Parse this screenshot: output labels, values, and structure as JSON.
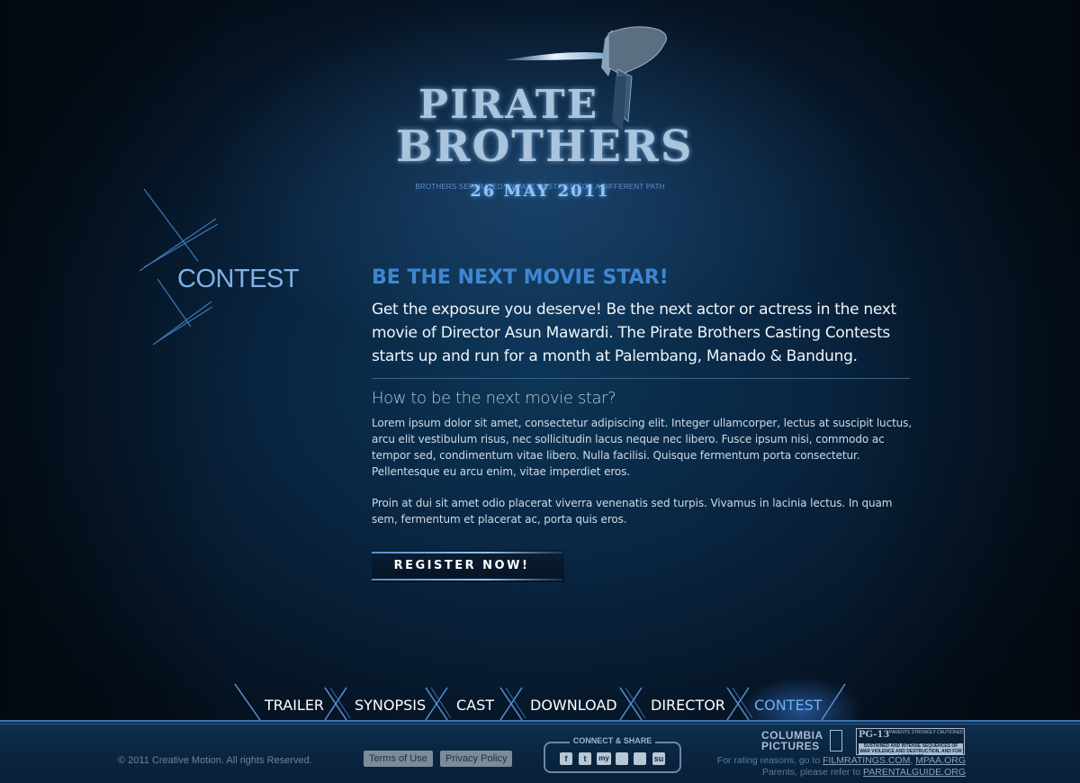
{
  "logo": {
    "title_line1": "PIRATE",
    "title_line2": "BROTHERS",
    "tagline": "BROTHERS SEPARATED BY FATE DESTINED FOR A DIFFERENT PATH"
  },
  "release_date": "26 MAY 2011",
  "section_title": "CONTEST",
  "main": {
    "headline": "BE THE NEXT MOVIE STAR!",
    "intro": "Get the exposure you deserve! Be the next actor or actress in the next movie of Director Asun Mawardi. The Pirate Brothers Casting Contests starts up and run for a month at Palembang, Manado & Bandung.",
    "subhead": "How to be the next movie star?",
    "paragraph1": "Lorem ipsum dolor sit amet, consectetur adipiscing elit. Integer ullamcorper, lectus at suscipit luctus, arcu elit vestibulum risus, nec sollicitudin lacus neque nec libero. Fusce ipsum nisi, commodo ac tempor sed, condimentum vitae libero. Nulla facilisi. Quisque fermentum porta consectetur. Pellentesque eu arcu enim, vitae imperdiet eros.",
    "paragraph2": "Proin at dui sit amet odio placerat viverra venenatis sed turpis. Vivamus in lacinia lectus. In quam sem, fermentum et placerat ac, porta quis eros.",
    "register_label": "REGISTER NOW!"
  },
  "nav": {
    "items": [
      {
        "label": "TRAILER",
        "active": false
      },
      {
        "label": "SYNOPSIS",
        "active": false
      },
      {
        "label": "CAST",
        "active": false
      },
      {
        "label": "DOWNLOAD",
        "active": false
      },
      {
        "label": "DIRECTOR",
        "active": false
      },
      {
        "label": "CONTEST",
        "active": true
      }
    ]
  },
  "footer": {
    "copyright": "© 2011 Creative Motion. All rights Reserved.",
    "terms_label": "Terms of Use",
    "privacy_label": "Privacy Policy",
    "connect_title": "CONNECT & SHARE",
    "social_icons": [
      "facebook-icon",
      "twitter-icon",
      "myspace-icon",
      "delicious-icon",
      "digg-icon",
      "stumbleupon-icon"
    ],
    "social_glyphs": [
      "f",
      "t",
      "my",
      "",
      "",
      "su"
    ],
    "studio_line1": "COLUMBIA",
    "studio_line2": "PICTURES",
    "rating_badge": "PG-13",
    "rating_caution": "PARENTS STRONGLY CAUTIONED",
    "rating_desc": "SUSTAINED AND INTENSE SEQUENCES OF WAR VIOLENCE AND DESTRUCTION, AND FOR LANGUAGE",
    "rating_reasons_text": "For rating reasons, go to",
    "filmratings_link": "FILMRATINGS.COM",
    "mpaa_link": "MPAA.ORG",
    "parents_text": "Parents, please refer to",
    "parentalguide_link": "PARENTALGUIDE.ORG"
  },
  "colors": {
    "accent": "#3f86d1",
    "nav_active": "#6fb0f0",
    "background": "#07182a"
  }
}
